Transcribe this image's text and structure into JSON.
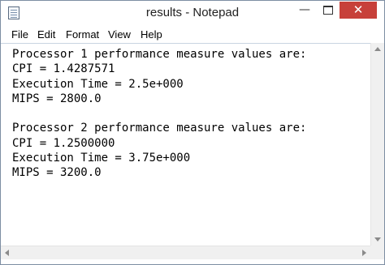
{
  "window": {
    "title": "results - Notepad",
    "close_glyph": "✕",
    "minimize_glyph": "—"
  },
  "menu": {
    "items": [
      "File",
      "Edit",
      "Format",
      "View",
      "Help"
    ]
  },
  "editor": {
    "lines": [
      "Processor 1 performance measure values are:",
      "CPI = 1.4287571",
      "Execution Time = 2.5e+000",
      "MIPS = 2800.0",
      "",
      "Processor 2 performance measure values are:",
      "CPI = 1.2500000",
      "Execution Time = 3.75e+000",
      "MIPS = 3200.0"
    ]
  },
  "icons": {
    "app": "notepad-icon",
    "close": "close-icon",
    "minimize": "minimize-icon",
    "maximize": "maximize-icon"
  },
  "colors": {
    "close_button": "#c7403a",
    "window_border": "#7d8ea3"
  }
}
